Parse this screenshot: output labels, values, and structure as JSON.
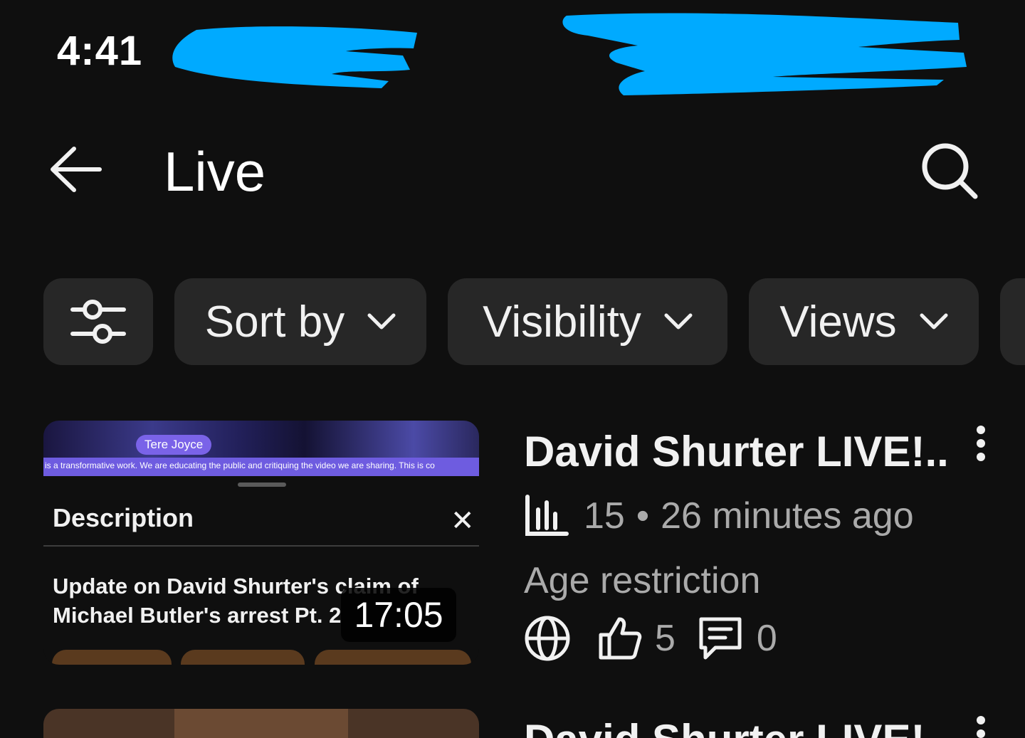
{
  "status_bar": {
    "time": "4:41"
  },
  "app_bar": {
    "title": "Live",
    "back_icon": "arrow-left-icon",
    "search_icon": "search-icon"
  },
  "filters": {
    "settings_icon": "sliders-icon",
    "chips": [
      {
        "label": "Sort by"
      },
      {
        "label": "Visibility"
      },
      {
        "label": "Views"
      }
    ]
  },
  "videos": [
    {
      "thumbnail": {
        "tag": "Tere Joyce",
        "banner_text": "is a transformative work. We are educating the public and critiquing the video we are sharing. This is co",
        "description_label": "Description",
        "title_line_1": "Update on David Shurter's claim of",
        "title_line_2": "Michael Butler's arrest Pt. 2"
      },
      "duration": "17:05",
      "title": "David Shurter LIVE!...",
      "views": "15",
      "separator": "•",
      "age": "26 minutes ago",
      "restriction": "Age restriction",
      "likes": "5",
      "comments": "0"
    },
    {
      "title": "David Shurter LIVE!"
    }
  ],
  "colors": {
    "background": "#0f0f0f",
    "chip": "#272727",
    "text_primary": "#f1f1f1",
    "text_secondary": "#aaaaaa",
    "redaction": "#00aaff"
  }
}
